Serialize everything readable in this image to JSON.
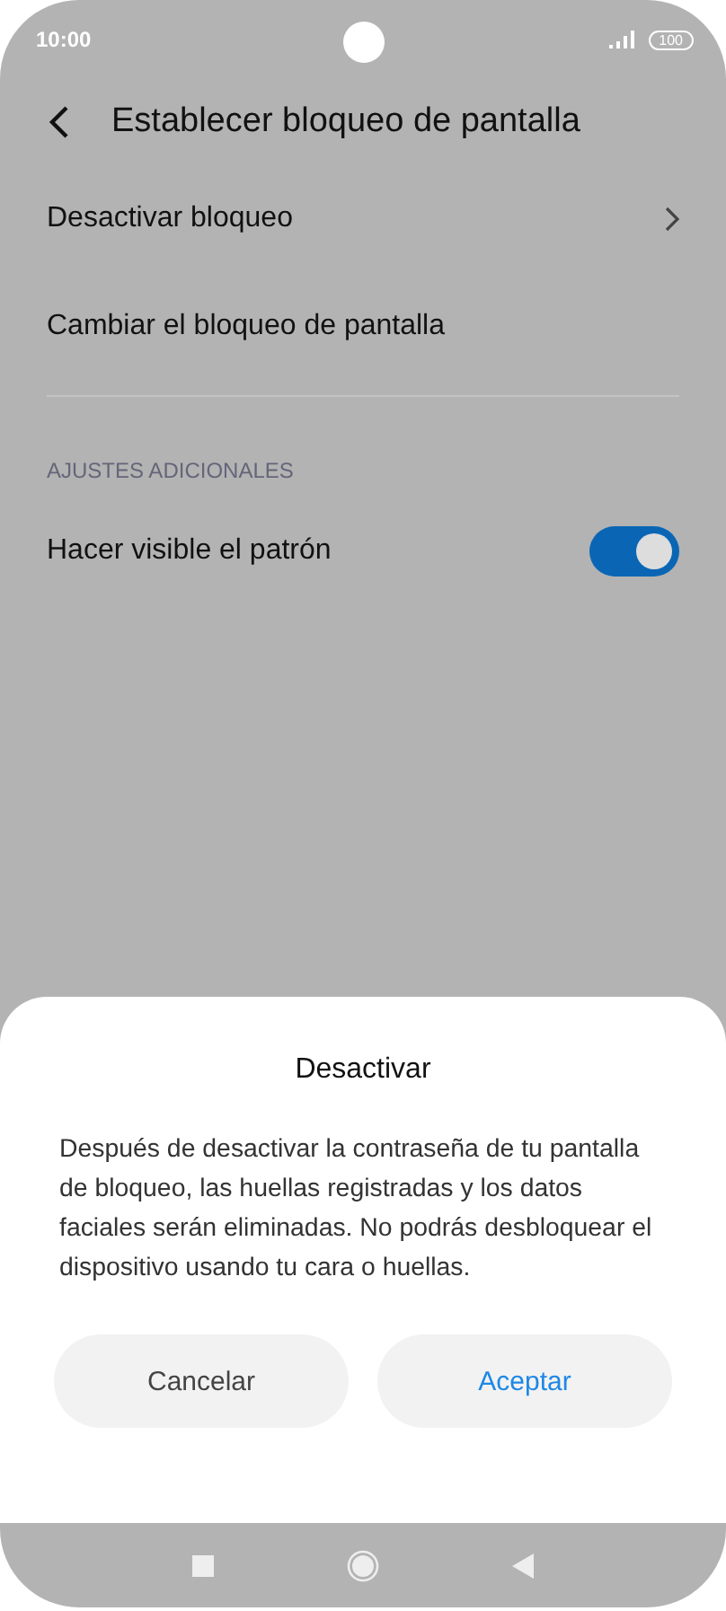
{
  "status_bar": {
    "time": "10:00",
    "battery": "100"
  },
  "header": {
    "title": "Establecer bloqueo de pantalla"
  },
  "items": [
    {
      "label": "Desactivar bloqueo",
      "kind": "link"
    },
    {
      "label": "Cambiar el bloqueo de pantalla",
      "kind": "plain"
    }
  ],
  "section": {
    "title": "AJUSTES ADICIONALES",
    "items": [
      {
        "label": "Hacer visible el patrón",
        "on": true
      }
    ]
  },
  "dialog": {
    "title": "Desactivar",
    "message": "Después de desactivar la contraseña de tu pantalla de bloqueo, las huellas registradas y los datos faciales serán eliminadas. No podrás desbloquear el dispositivo usando tu cara o huellas.",
    "buttons": [
      {
        "label": "Cancelar",
        "kind": "cancel"
      },
      {
        "label": "Aceptar",
        "kind": "confirm"
      }
    ]
  }
}
